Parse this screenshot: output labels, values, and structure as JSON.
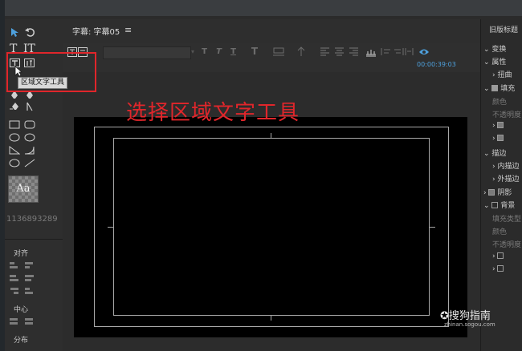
{
  "header": {
    "title": "字幕: 字幕05",
    "menu_glyph": "≡"
  },
  "toolbar": {
    "timecode": "00:00:39:03"
  },
  "tools": {
    "tooltip": "区域文字工具",
    "style_sample": "Aa",
    "id_number": "1136893289",
    "align_label": "对齐",
    "center_label": "中心",
    "distribute_label": "分布"
  },
  "annotation": {
    "text": "选择区域文字工具"
  },
  "right_panel": {
    "title": "旧版标题",
    "transform": "变换",
    "properties": "属性",
    "distort": "扭曲",
    "fill": "填充",
    "color": "颜色",
    "opacity": "不透明度",
    "strokes": "描边",
    "inner_strokes": "内描边",
    "outer_strokes": "外描边",
    "shadow": "阴影",
    "background": "背景",
    "fill_type": "填充类型",
    "bg_color": "颜色",
    "bg_opacity": "不透明度"
  },
  "watermark": {
    "brand": "搜狗指南",
    "url": "zhinan.sogou.com"
  },
  "colors": {
    "accent": "#4ea0dc",
    "annotation": "#e0262b"
  }
}
